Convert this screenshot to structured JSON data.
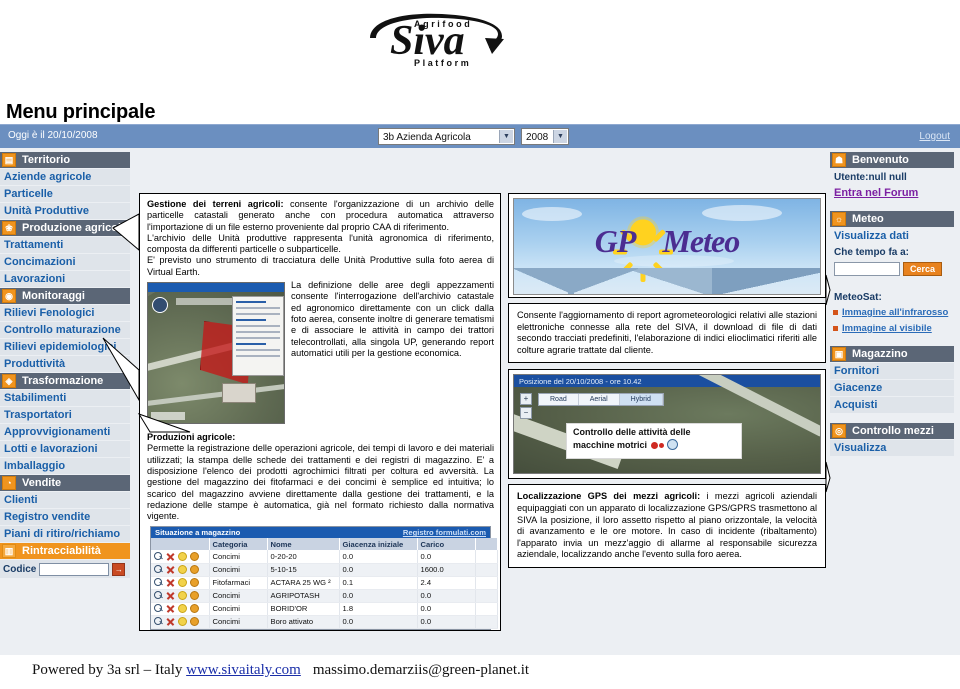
{
  "logo": {
    "top_text": "A g r i f o o d",
    "main_text": "Siva",
    "bottom_text": "P l a t f o r m"
  },
  "page_title": "Menu principale",
  "topbar": {
    "date_label": "Oggi è il 20/10/2008",
    "azienda_select": "3b Azienda Agricola",
    "anno_select": "2008",
    "logout_label": "Logout"
  },
  "left_sidebar": {
    "groups": [
      {
        "header": "Territorio",
        "icon": "document-icon",
        "style": "dark",
        "items": [
          "Aziende agricole",
          "Particelle",
          "Unità Produttive"
        ]
      },
      {
        "header": "Produzione agricola",
        "icon": "plant-icon",
        "style": "dark",
        "items": [
          "Trattamenti",
          "Concimazioni",
          "Lavorazioni"
        ]
      },
      {
        "header": "Monitoraggi",
        "icon": "chart-icon",
        "style": "dark",
        "items": [
          "Rilievi Fenologici",
          "Controllo maturazione",
          "Rilievi epidemiologici",
          "Produttività"
        ]
      },
      {
        "header": "Trasformazione",
        "icon": "factory-icon",
        "style": "dark",
        "items": [
          "Stabilimenti",
          "Trasportatori",
          "Approvvigionamenti",
          "Lotti e lavorazioni",
          "Imballaggio"
        ]
      },
      {
        "header": "Vendite",
        "icon": "cart-icon",
        "style": "dark",
        "items": [
          "Clienti",
          "Registro vendite",
          "Piani di ritiro/richiamo"
        ]
      },
      {
        "header": "Rintracciabilità",
        "icon": "barcode-icon",
        "style": "orange",
        "items": []
      }
    ],
    "codice": {
      "label": "Codice",
      "value": "",
      "go_label": "→"
    }
  },
  "right_sidebar": {
    "benvenuto": {
      "header": "Benvenuto",
      "icon": "user-icon",
      "user_line": "Utente:null null",
      "forum_link": "Entra nel Forum"
    },
    "meteo": {
      "header": "Meteo",
      "icon": "sun-icon",
      "visualizza_link": "Visualizza dati",
      "search_label": "Che tempo fa a:",
      "search_value": "",
      "search_button": "Cerca",
      "meteosat_label": "MeteoSat:",
      "links": [
        "Immagine all'infrarosso",
        "Immagine al visibile"
      ]
    },
    "magazzino": {
      "header": "Magazzino",
      "icon": "box-icon",
      "items": [
        "Fornitori",
        "Giacenze",
        "Acquisti"
      ]
    },
    "controllo_mezzi": {
      "header": "Controllo mezzi",
      "icon": "truck-icon",
      "items": [
        "Visualizza"
      ]
    }
  },
  "middle_column": {
    "terreni": {
      "heading": "Gestione dei terreni agricoli:",
      "body": " consente l'organizzazione di un archivio delle particelle catastali generato anche con procedura automatica attraverso l'importazione di un file esterno proveniente dal proprio CAA di riferimento.",
      "para2": "L'archivio delle Unità produttive rappresenta l'unità agronomica di riferimento, composta da differenti particelle o subparticelle.",
      "para3": "E' previsto uno strumento di tracciatura delle Unità Produttive sulla foto aerea di Virtual Earth.",
      "para4": "La definizione delle aree degli appezzamenti consente l'interrogazione dell'archivio catastale ed agronomico direttamente con un click dalla foto aerea, consente inoltre di generare tematismi e di associare le attività in campo dei trattori telecontrollati, alla singola UP, generando report automatici utili per la gestione economica."
    },
    "produzioni": {
      "heading": "Produzioni agricole:",
      "body": "Permette la registrazione delle operazioni agricole, dei tempi di lavoro e dei materiali utilizzati; la stampa delle schede dei trattamenti e dei registri di magazzino. E' a disposizione l'elenco dei prodotti agrochimici filtrati per coltura ed avversità. La gestione del magazzino dei fitofarmaci e dei concimi è semplice ed intuitiva; lo scarico del magazzino avviene direttamente dalla gestione dei trattamenti, e la redazione delle stampe è automatica, già nel formato richiesto dalla normativa vigente."
    },
    "table": {
      "title_left": "Situazione a magazzino",
      "title_right": "Registro formulati.com",
      "columns": [
        "",
        "Categoria",
        "Nome",
        "Giacenza iniziale",
        "Carico",
        ""
      ],
      "rows": [
        [
          "",
          "Concimi",
          "0-20-20",
          "0.0",
          "0.0",
          ""
        ],
        [
          "",
          "Concimi",
          "5-10-15",
          "0.0",
          "1600.0",
          ""
        ],
        [
          "",
          "Fitofarmaci",
          "ACTARA 25 WG ²",
          "0.1",
          "2.4",
          ""
        ],
        [
          "",
          "Concimi",
          "AGRIPOTASH",
          "0.0",
          "0.0",
          ""
        ],
        [
          "",
          "Concimi",
          "BORID'OR",
          "1.8",
          "0.0",
          ""
        ],
        [
          "",
          "Concimi",
          "Boro attivato",
          "0.0",
          "0.0",
          ""
        ]
      ]
    },
    "map_thumb_label": "aerial-map-thumbnail"
  },
  "right_column": {
    "gpo": {
      "banner_text_left": "GP",
      "banner_text_right": "Meteo",
      "description": "Consente l'aggiornamento di report agrometeorologici relativi alle stazioni elettroniche connesse alla rete del SIVA, il download di file di dati secondo tracciati predefiniti, l'elaborazione di indici elioclimatici riferiti alle colture agrarie trattate dal cliente."
    },
    "gps": {
      "map_title": "Posizione del 20/10/2008 - ore 10.42",
      "map_tabs": [
        "Road",
        "Aerial",
        "Hybrid"
      ],
      "selected_tab": "Hybrid",
      "callout_line1": "Controllo delle attività delle",
      "callout_line2": "macchine motrici",
      "heading": "Localizzazione GPS dei mezzi agricoli:",
      "body": " i mezzi agricoli aziendali equipaggiati con un apparato di localizzazione GPS/GPRS trasmettono al SIVA la posizione, il loro assetto rispetto al piano orizzontale,  la velocità di avanzamento e le ore motore. In caso di incidente (ribaltamento) l'apparato invia un mezz'aggio di allarme al responsabile sicurezza aziendale, localizzando anche l'evento sulla foro aerea."
    }
  },
  "footer": {
    "prefix": "Powered by 3a srl – Italy ",
    "link": "www.sivaitaly.com",
    "email": "massimo.demarziis@green-planet.it"
  },
  "colors": {
    "menu_header_dark": "#5b6676",
    "menu_header_orange": "#f0941e",
    "menu_item_bg": "#dfe4ea",
    "menu_item_text": "#1a5fa8",
    "topbar_blue": "#6b8fc0",
    "table_header_blue": "#1b5bb0",
    "forum_link": "#7b1fa2"
  }
}
